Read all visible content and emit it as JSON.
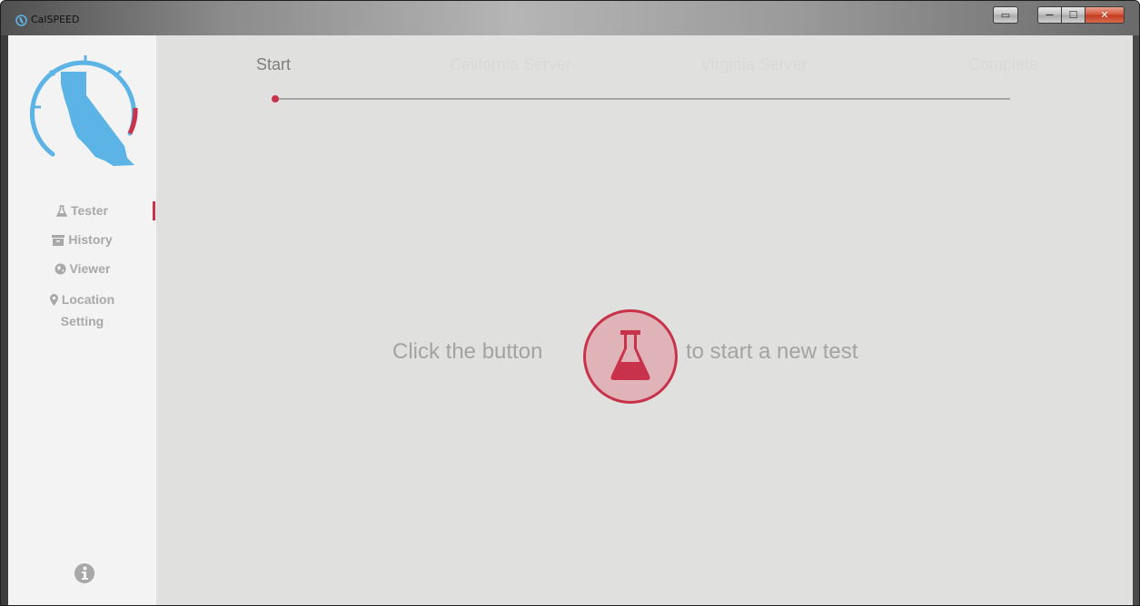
{
  "window": {
    "title": "CalSPEED",
    "controls": {
      "restore_view": "▭",
      "minimize": "—",
      "maximize": "☐",
      "close": "✕"
    }
  },
  "sidebar": {
    "items": [
      {
        "label": "Tester",
        "icon": "flask-icon",
        "active": true
      },
      {
        "label": "History",
        "icon": "archive-icon",
        "active": false
      },
      {
        "label": "Viewer",
        "icon": "globe-icon",
        "active": false
      },
      {
        "label_line1": "Location",
        "label_line2": "Setting",
        "icon": "map-pin-icon",
        "active": false
      }
    ],
    "info_icon": "info-icon"
  },
  "steps": [
    {
      "label": "Start",
      "active": true
    },
    {
      "label": "California Server",
      "active": false
    },
    {
      "label": "Virginia Server",
      "active": false
    },
    {
      "label": "Complete",
      "active": false
    }
  ],
  "cta": {
    "before": "Click the button",
    "after": "to start a new test"
  },
  "colors": {
    "accent": "#c8334b",
    "logo_blue": "#5bb4e5",
    "sidebar_bg": "#f3f3f3",
    "main_bg": "#e0e0de",
    "text_muted": "#a3a3a3"
  }
}
